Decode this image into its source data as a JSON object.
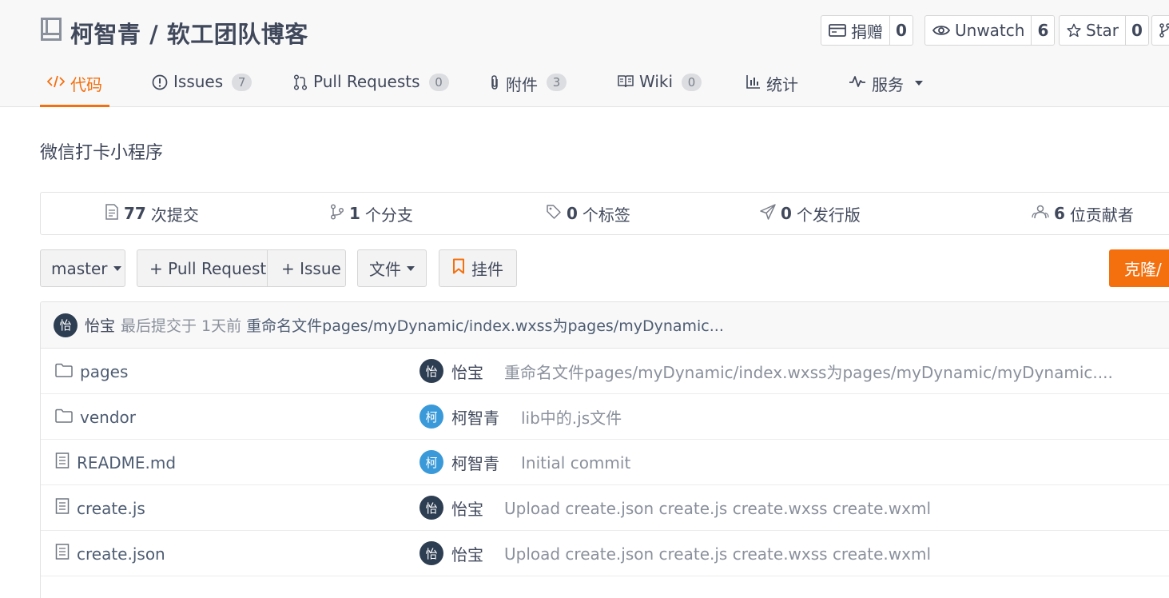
{
  "repo": {
    "title": "柯智青 / 软工团队博客",
    "description": "微信打卡小程序"
  },
  "actions": {
    "donate": {
      "label": "捐赠",
      "count": "0"
    },
    "watch": {
      "label": "Unwatch",
      "count": "6"
    },
    "star": {
      "label": "Star",
      "count": "0"
    }
  },
  "tabs": [
    {
      "label": "代码",
      "badge": ""
    },
    {
      "label": "Issues",
      "badge": "7"
    },
    {
      "label": "Pull Requests",
      "badge": "0"
    },
    {
      "label": "附件",
      "badge": "3"
    },
    {
      "label": "Wiki",
      "badge": "0"
    },
    {
      "label": "统计",
      "badge": ""
    },
    {
      "label": "服务",
      "badge": ""
    }
  ],
  "stats": [
    {
      "num": "77",
      "label": "次提交"
    },
    {
      "num": "1",
      "label": "个分支"
    },
    {
      "num": "0",
      "label": "个标签"
    },
    {
      "num": "0",
      "label": "个发行版"
    },
    {
      "num": "6",
      "label": "位贡献者"
    }
  ],
  "toolbar": {
    "branch": "master",
    "pull_request": "+ Pull Request",
    "issue": "+ Issue",
    "files": "文件",
    "widget": "挂件",
    "clone": "克隆/"
  },
  "last_commit": {
    "avatar": "怡",
    "author": "怡宝",
    "meta": "最后提交于 1天前",
    "message": "重命名文件pages/myDynamic/index.wxss为pages/myDynamic..."
  },
  "files": [
    {
      "name": "pages",
      "type": "folder",
      "avatar": "怡",
      "author": "怡宝",
      "message": "重命名文件pages/myDynamic/index.wxss为pages/myDynamic/myDynamic...."
    },
    {
      "name": "vendor",
      "type": "folder",
      "avatar": "柯",
      "author": "柯智青",
      "message": "lib中的.js文件"
    },
    {
      "name": "README.md",
      "type": "file",
      "avatar": "柯",
      "author": "柯智青",
      "message": "Initial commit"
    },
    {
      "name": "create.js",
      "type": "file",
      "avatar": "怡",
      "author": "怡宝",
      "message": "Upload create.json create.js create.wxss create.wxml"
    },
    {
      "name": "create.json",
      "type": "file",
      "avatar": "怡",
      "author": "怡宝",
      "message": "Upload create.json create.js create.wxss create.wxml"
    }
  ],
  "colors": {
    "accent": "#f4700f",
    "text": "#40485b",
    "link": "#4e5d73",
    "muted": "#8a909c"
  }
}
